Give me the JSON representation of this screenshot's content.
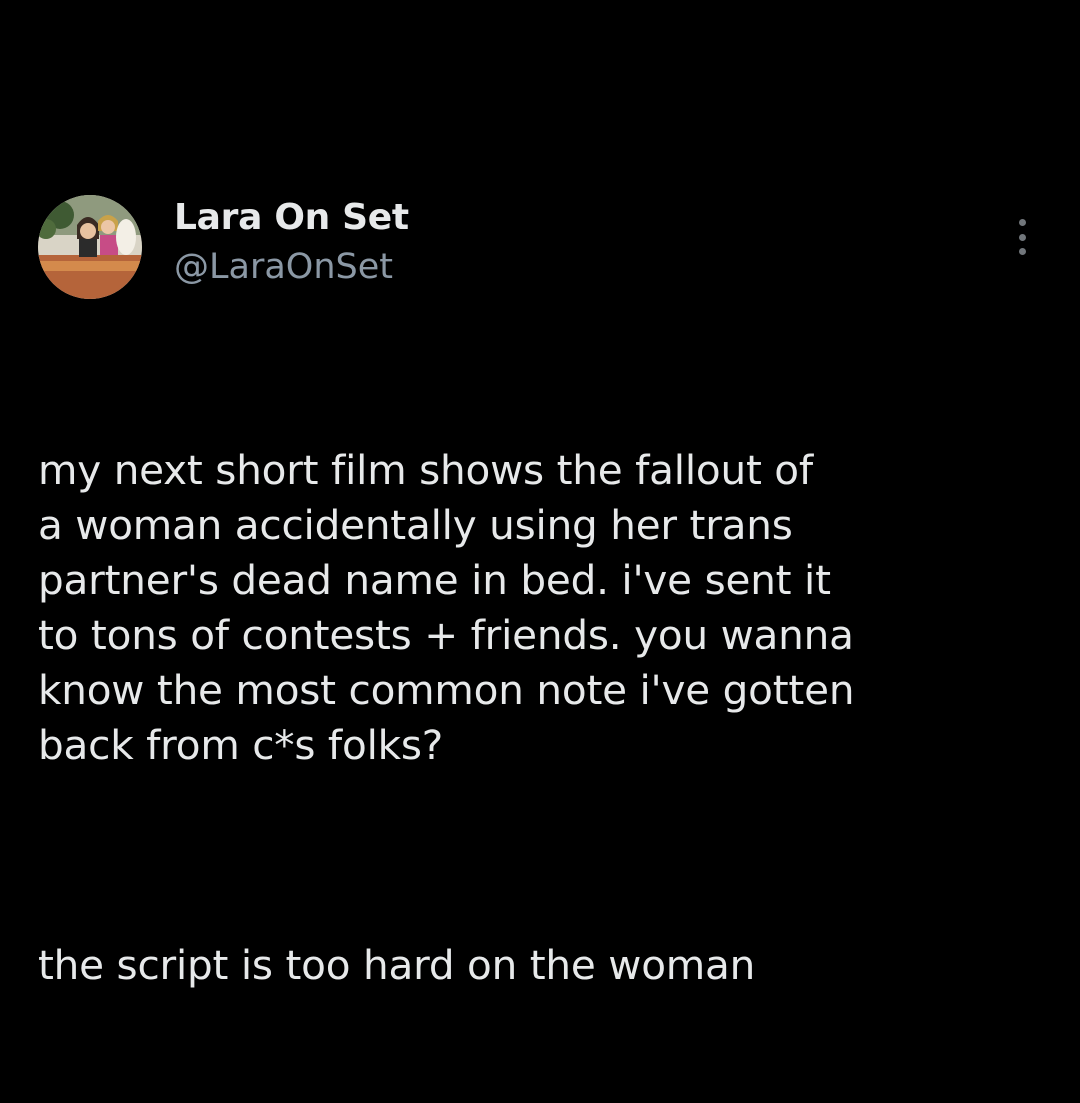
{
  "author": {
    "display_name": "Lara On Set",
    "handle": "@LaraOnSet"
  },
  "more_icon": "more-vertical-icon",
  "tweet": {
    "paragraphs": [
      "my next short film shows the fallout of\na woman accidentally using her trans\npartner's dead name in bed. i've sent it\nto tons of contests + friends. you wanna\nknow the most common note i've gotten\nback from c*s folks?",
      "the script is too hard on the woman"
    ]
  },
  "colors": {
    "background": "#000000",
    "text": "#e7e9ea",
    "handle": "#8b98a5",
    "icon": "#71767b"
  }
}
